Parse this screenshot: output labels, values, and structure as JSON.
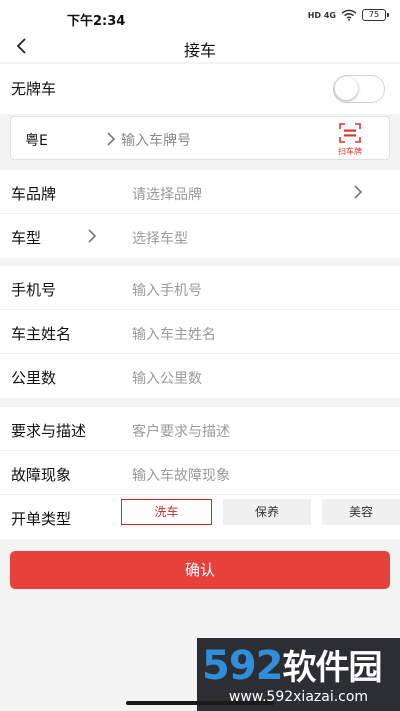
{
  "status_bar": {
    "time": "下午2:34",
    "signal": "HD 4G",
    "battery": "75"
  },
  "nav": {
    "title": "接车"
  },
  "unplated": {
    "label": "无牌车",
    "toggle_on": false
  },
  "plate": {
    "prefix": "粤E",
    "placeholder": "输入车牌号",
    "scan_label": "扫车牌"
  },
  "vehicle": {
    "brand_label": "车品牌",
    "brand_placeholder": "请选择品牌",
    "model_label": "车型",
    "model_placeholder": "选择车型"
  },
  "owner": {
    "phone_label": "手机号",
    "phone_placeholder": "输入手机号",
    "name_label": "车主姓名",
    "name_placeholder": "输入车主姓名",
    "mileage_label": "公里数",
    "mileage_placeholder": "输入公里数"
  },
  "request": {
    "desc_label": "要求与描述",
    "desc_placeholder": "客户要求与描述",
    "fault_label": "故障现象",
    "fault_placeholder": "输入车故障现象",
    "order_type_label": "开单类型",
    "order_types": [
      "洗车",
      "保养",
      "美容"
    ],
    "selected_order_type": "洗车"
  },
  "confirm_label": "确认",
  "watermark": {
    "logo_number": "592",
    "logo_text": "软件园",
    "url": "www.592xiazai.com"
  },
  "colors": {
    "accent": "#e8403a",
    "selected_border": "#c62a2a",
    "watermark_blue": "#2f8fd8"
  }
}
